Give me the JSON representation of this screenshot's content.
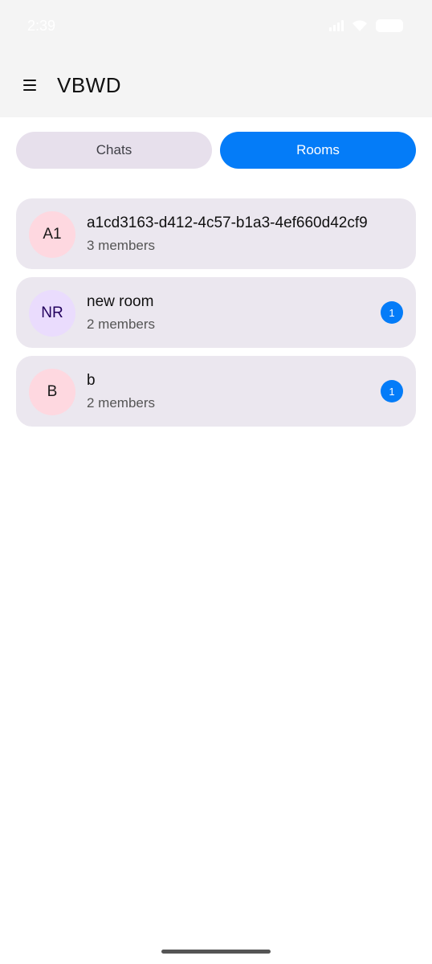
{
  "status_bar": {
    "time": "2:39"
  },
  "app_bar": {
    "title": "VBWD",
    "menu_icon": "hamburger-menu-icon"
  },
  "tabs": [
    {
      "label": "Chats",
      "active": false
    },
    {
      "label": "Rooms",
      "active": true
    }
  ],
  "rooms": [
    {
      "initials": "A1",
      "name": "a1cd3163-d412-4c57-b1a3-4ef660d42cf9",
      "members": "3 members",
      "unread": "",
      "avatar_bg": "#fed8e0",
      "avatar_fg": "#1a1a1a"
    },
    {
      "initials": "NR",
      "name": "new room",
      "members": "2 members",
      "unread": "1",
      "avatar_bg": "#eadcfd",
      "avatar_fg": "#22005d"
    },
    {
      "initials": "B",
      "name": "b",
      "members": "2 members",
      "unread": "1",
      "avatar_bg": "#fed8e0",
      "avatar_fg": "#1a1a1a"
    }
  ],
  "colors": {
    "accent": "#047cf8",
    "card_bg": "#ebe7ef",
    "tab_inactive_bg": "#e7e0ec",
    "app_bar_bg": "#f4f4f4"
  }
}
